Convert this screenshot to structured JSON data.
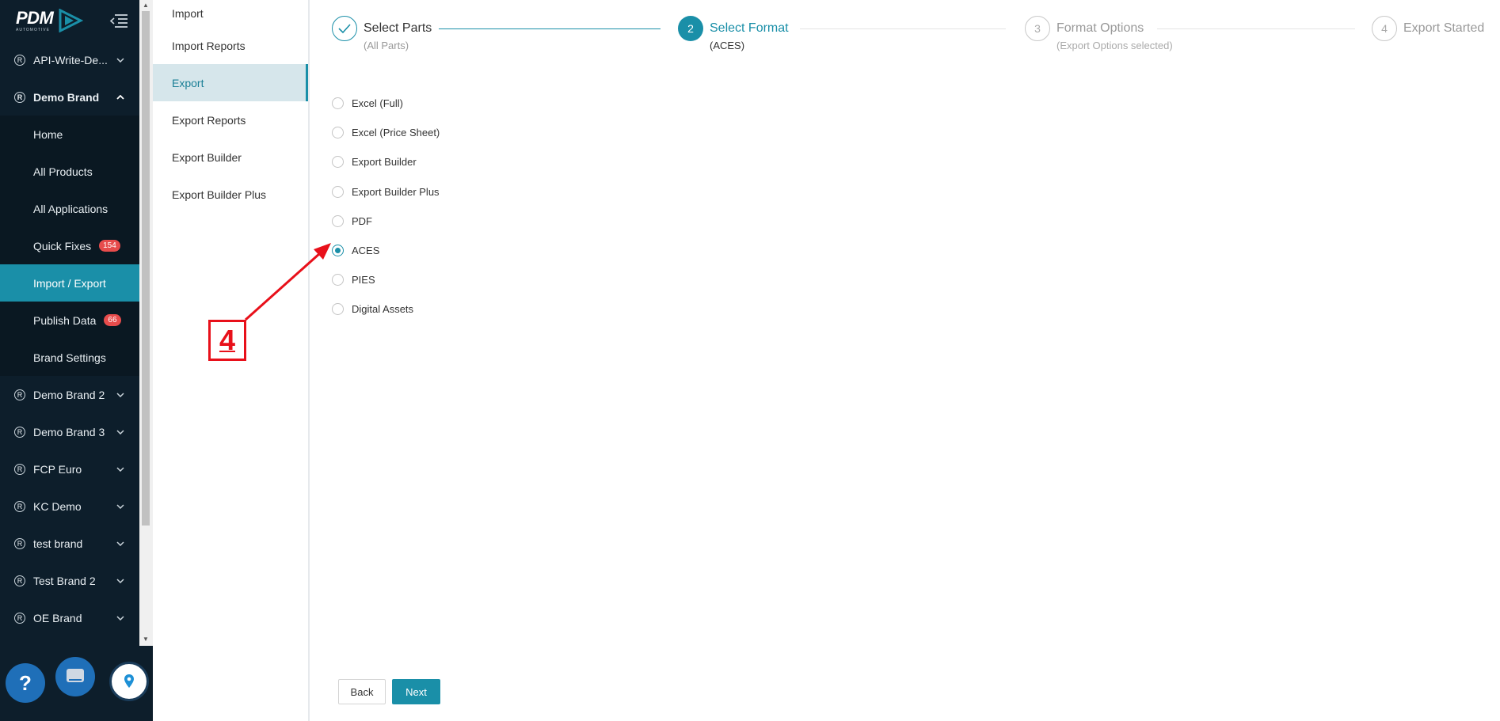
{
  "logo": {
    "text": "PDM",
    "sub": "AUTOMOTIVE"
  },
  "sidebar": {
    "items": [
      {
        "label": "API-Write-De...",
        "expanded": false
      },
      {
        "label": "Demo Brand",
        "expanded": true
      }
    ],
    "subitems": [
      {
        "label": "Home"
      },
      {
        "label": "All Products"
      },
      {
        "label": "All Applications"
      },
      {
        "label": "Quick Fixes",
        "badge": "154"
      },
      {
        "label": "Import / Export",
        "active": true
      },
      {
        "label": "Publish Data",
        "badge": "66"
      },
      {
        "label": "Brand Settings"
      }
    ],
    "brands": [
      {
        "label": "Demo Brand 2"
      },
      {
        "label": "Demo Brand 3"
      },
      {
        "label": "FCP Euro"
      },
      {
        "label": "KC Demo"
      },
      {
        "label": "test brand"
      },
      {
        "label": "Test Brand 2"
      },
      {
        "label": "OE Brand"
      }
    ],
    "reg_symbol": "R"
  },
  "submenu": {
    "items": [
      {
        "label": "Import"
      },
      {
        "label": "Import Reports"
      },
      {
        "label": "Export",
        "active": true
      },
      {
        "label": "Export Reports"
      },
      {
        "label": "Export Builder"
      },
      {
        "label": "Export Builder Plus"
      }
    ]
  },
  "steps": [
    {
      "number": "",
      "title": "Select Parts",
      "subtitle": "(All Parts)",
      "state": "done"
    },
    {
      "number": "2",
      "title": "Select Format",
      "subtitle": "(ACES)",
      "state": "current"
    },
    {
      "number": "3",
      "title": "Format Options",
      "subtitle": "(Export Options selected)",
      "state": "pending"
    },
    {
      "number": "4",
      "title": "Export Started",
      "subtitle": "",
      "state": "pending"
    }
  ],
  "formats": {
    "options": [
      {
        "label": "Excel (Full)",
        "checked": false
      },
      {
        "label": "Excel (Price Sheet)",
        "checked": false
      },
      {
        "label": "Export Builder",
        "checked": false
      },
      {
        "label": "Export Builder Plus",
        "checked": false
      },
      {
        "label": "PDF",
        "checked": false
      },
      {
        "label": "ACES",
        "checked": true
      },
      {
        "label": "PIES",
        "checked": false
      },
      {
        "label": "Digital Assets",
        "checked": false
      }
    ]
  },
  "buttons": {
    "back": "Back",
    "next": "Next"
  },
  "annotation": {
    "label": "4",
    "color": "#e8101a"
  },
  "colors": {
    "accent": "#1a8fa8",
    "sidebar_bg": "#0d1e2b",
    "badge": "#e74c4c"
  }
}
